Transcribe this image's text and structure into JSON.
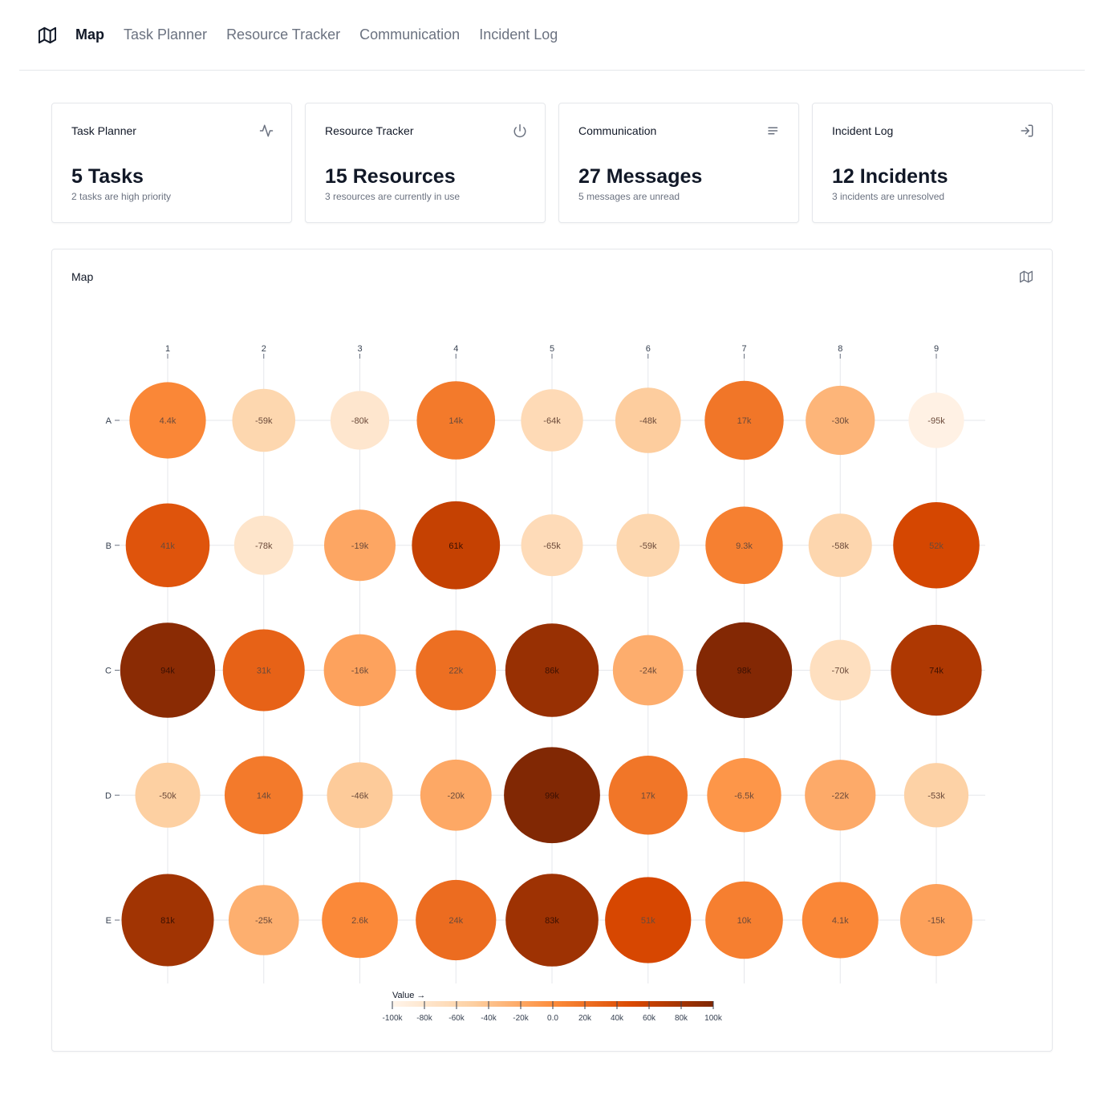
{
  "nav": {
    "logo_icon": "map-icon",
    "items": [
      {
        "label": "Map",
        "active": true
      },
      {
        "label": "Task Planner",
        "active": false
      },
      {
        "label": "Resource Tracker",
        "active": false
      },
      {
        "label": "Communication",
        "active": false
      },
      {
        "label": "Incident Log",
        "active": false
      }
    ]
  },
  "stats": [
    {
      "title": "Task Planner",
      "icon": "activity-icon",
      "value": "5 Tasks",
      "sub": "2 tasks are high priority"
    },
    {
      "title": "Resource Tracker",
      "icon": "power-icon",
      "value": "15 Resources",
      "sub": "3 resources are currently in use"
    },
    {
      "title": "Communication",
      "icon": "align-left-icon",
      "value": "27 Messages",
      "sub": "5 messages are unread"
    },
    {
      "title": "Incident Log",
      "icon": "log-in-icon",
      "value": "12 Incidents",
      "sub": "3 incidents are unresolved"
    }
  ],
  "map_card": {
    "title": "Map",
    "icon": "map-icon"
  },
  "chart_data": {
    "type": "heatmap",
    "columns": [
      "1",
      "2",
      "3",
      "4",
      "5",
      "6",
      "7",
      "8",
      "9"
    ],
    "rows": [
      "A",
      "B",
      "C",
      "D",
      "E"
    ],
    "values": [
      [
        4400,
        -59000,
        -80000,
        14000,
        -64000,
        -48000,
        17000,
        -30000,
        -95000
      ],
      [
        41000,
        -78000,
        -19000,
        61000,
        -65000,
        -59000,
        9300,
        -58000,
        52000
      ],
      [
        94000,
        31000,
        -16000,
        22000,
        86000,
        -24000,
        98000,
        -70000,
        74000
      ],
      [
        -50000,
        14000,
        -46000,
        -20000,
        99000,
        17000,
        -6500,
        -22000,
        -53000
      ],
      [
        81000,
        -25000,
        2600,
        24000,
        83000,
        51000,
        10000,
        4100,
        -15000
      ]
    ],
    "labels": [
      [
        "4.4k",
        "-59k",
        "-80k",
        "14k",
        "-64k",
        "-48k",
        "17k",
        "-30k",
        "-95k"
      ],
      [
        "41k",
        "-78k",
        "-19k",
        "61k",
        "-65k",
        "-59k",
        "9.3k",
        "-58k",
        "52k"
      ],
      [
        "94k",
        "31k",
        "-16k",
        "22k",
        "86k",
        "-24k",
        "98k",
        "-70k",
        "74k"
      ],
      [
        "-50k",
        "14k",
        "-46k",
        "-20k",
        "99k",
        "17k",
        "-6.5k",
        "-22k",
        "-53k"
      ],
      [
        "81k",
        "-25k",
        "2.6k",
        "24k",
        "83k",
        "51k",
        "10k",
        "4.1k",
        "-15k"
      ]
    ],
    "legend": {
      "title": "Value →",
      "domain": [
        -100000,
        100000
      ],
      "ticks": [
        "-100k",
        "-80k",
        "-60k",
        "-40k",
        "-20k",
        "0.0",
        "20k",
        "40k",
        "60k",
        "80k",
        "100k"
      ],
      "colors": [
        "#fff5eb",
        "#fdd0a2",
        "#fd8d3c",
        "#d94801",
        "#7f2704"
      ]
    }
  }
}
